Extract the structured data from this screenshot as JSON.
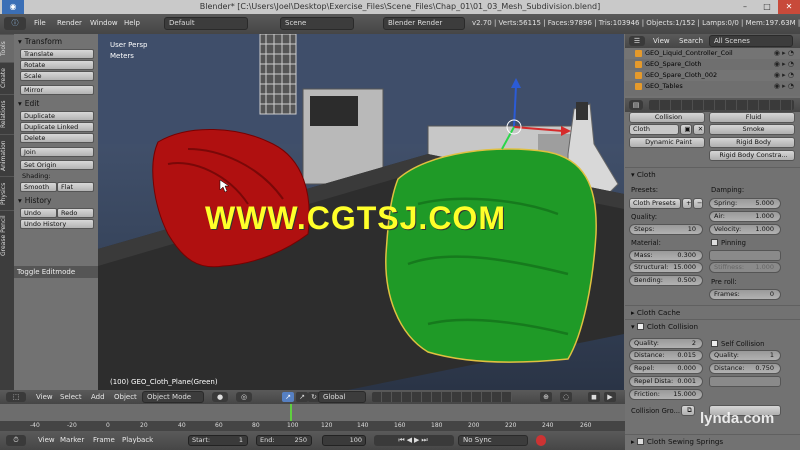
{
  "window_title": "Blender* [C:\\Users\\Joel\\Desktop\\Exercise_Files\\Scene_Files\\Chap_01\\01_03_Mesh_Subdivision.blend]",
  "info_header": {
    "menus": [
      "File",
      "Render",
      "Window",
      "Help"
    ],
    "layout": "Default",
    "scene": "Scene",
    "engine": "Blender Render",
    "stats": "v2.70 | Verts:56115 | Faces:97896 | Tris:103946 | Objects:1/152 | Lamps:0/0 | Mem:197.63M | GEO_Cloth"
  },
  "toolshelf": {
    "tabs": [
      "Tools",
      "Create",
      "Relations",
      "Animation",
      "Physics",
      "Grease Pencil"
    ],
    "transform_header": "Transform",
    "transform_buttons": [
      "Translate",
      "Rotate",
      "Scale"
    ],
    "mirror": "Mirror",
    "edit_header": "Edit",
    "edit_buttons": [
      "Duplicate",
      "Duplicate Linked",
      "Delete"
    ],
    "join": "Join",
    "set_origin": "Set Origin",
    "shading_label": "Shading:",
    "smooth": "Smooth",
    "flat": "Flat",
    "history_header": "History",
    "undo": "Undo",
    "redo": "Redo",
    "undo_history": "Undo History",
    "toggle_editmode": "Toggle Editmode"
  },
  "viewport": {
    "view_name": "User Persp",
    "units": "Meters",
    "object_label": "(100) GEO_Cloth_Plane(Green)"
  },
  "view_header": {
    "menus": [
      "View",
      "Select",
      "Add",
      "Object"
    ],
    "mode": "Object Mode",
    "orientation": "Global"
  },
  "timeline": {
    "ticks": [
      "-40",
      "-20",
      "0",
      "20",
      "40",
      "60",
      "80",
      "100",
      "120",
      "140",
      "160",
      "180",
      "200",
      "220",
      "240",
      "260"
    ],
    "menus": [
      "View",
      "Marker",
      "Frame",
      "Playback"
    ],
    "start_label": "Start:",
    "start": "1",
    "end_label": "End:",
    "end": "250",
    "current": "100",
    "sync": "No Sync"
  },
  "outliner": {
    "header_menus": [
      "View",
      "Search"
    ],
    "filter": "All Scenes",
    "items": [
      "GEO_Liquid_Controller_Coil",
      "GEO_Spare_Cloth",
      "GEO_Spare_Cloth_002",
      "GEO_Tables"
    ]
  },
  "physics": {
    "row0_left": "Collision",
    "row0_right": "Fluid",
    "cloth_btn": "Cloth",
    "smoke_btn": "Smoke",
    "dynamic_paint": "Dynamic Paint",
    "rigid_body": "Rigid Body",
    "rigid_body_constraint": "Rigid Body Constra...",
    "cloth_section": "Cloth",
    "presets_label": "Presets:",
    "presets_value": "Cloth Presets",
    "quality_label": "Quality:",
    "steps_label": "Steps:",
    "steps": "10",
    "material_label": "Material:",
    "mass_label": "Mass:",
    "mass": "0.300",
    "structural_label": "Structural:",
    "structural": "15.000",
    "bending_label": "Bending:",
    "bending": "0.500",
    "damping_label": "Damping:",
    "spring_label": "Spring:",
    "spring": "5.000",
    "air_label": "Air:",
    "air": "1.000",
    "velocity_label": "Velocity:",
    "velocity": "1.000",
    "pinning_label": "Pinning",
    "stiffness_label": "Stiffness:",
    "stiffness": "1.000",
    "preroll_label": "Pre roll:",
    "frames_label": "Frames:",
    "frames": "0",
    "cache_section": "Cloth Cache",
    "collision_section": "Cloth Collision",
    "c_quality_label": "Quality:",
    "c_quality": "2",
    "distance_label": "Distance:",
    "distance": "0.015",
    "repel_label": "Repel:",
    "repel": "0.000",
    "repel_dist_label": "Repel Dista:",
    "repel_dist": "0.001",
    "friction_label": "Friction:",
    "friction": "15.000",
    "self_collision_label": "Self Collision",
    "sc_quality_label": "Quality:",
    "sc_quality": "1",
    "sc_distance_label": "Distance:",
    "sc_distance": "0.750",
    "collision_group_label": "Collision Gro...",
    "sewing_section": "Cloth Sewing Springs"
  },
  "watermark": "WWW.CGTSJ.COM",
  "brand": "lynda.com"
}
